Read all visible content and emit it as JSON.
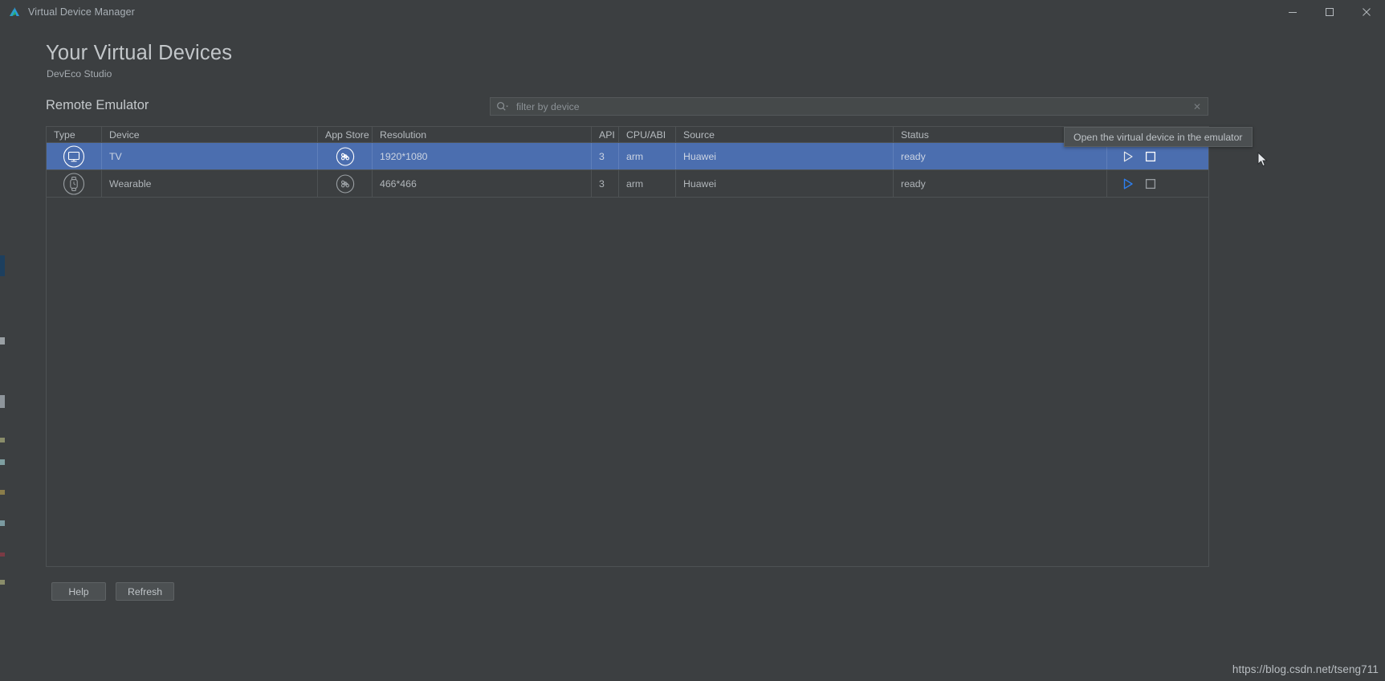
{
  "window": {
    "title": "Virtual Device Manager",
    "app_icon": "deveco-logo-icon",
    "controls": {
      "minimize": "minimize-icon",
      "maximize": "maximize-icon",
      "close": "close-icon"
    }
  },
  "header": {
    "title": "Your Virtual Devices",
    "subtitle": "DevEco Studio",
    "section_title": "Remote Emulator"
  },
  "search": {
    "placeholder": "filter by device",
    "value": "",
    "icon": "search-icon",
    "clear_icon": "clear-icon"
  },
  "table": {
    "columns": [
      "Type",
      "Device",
      "App Store",
      "Resolution",
      "API",
      "CPU/ABI",
      "Source",
      "Status",
      ""
    ],
    "rows": [
      {
        "type_icon": "tv-icon",
        "device": "TV",
        "app_store_icon": "app-store-icon",
        "resolution": "1920*1080",
        "api": "3",
        "cpu_abi": "arm",
        "source": "Huawei",
        "status": "ready",
        "selected": true,
        "actions": [
          "play-icon",
          "stop-icon"
        ]
      },
      {
        "type_icon": "wearable-icon",
        "device": "Wearable",
        "app_store_icon": "app-store-icon",
        "resolution": "466*466",
        "api": "3",
        "cpu_abi": "arm",
        "source": "Huawei",
        "status": "ready",
        "selected": false,
        "actions": [
          "play-icon",
          "stop-icon"
        ]
      }
    ]
  },
  "tooltip": {
    "text": "Open the virtual device in the emulator"
  },
  "footer": {
    "help_label": "Help",
    "refresh_label": "Refresh"
  },
  "watermark": {
    "text": "https://blog.csdn.net/tseng711"
  },
  "colors": {
    "background": "#3c3f41",
    "selection": "#4b6eaf",
    "accent_blue": "#3592f2",
    "border": "#4e5254",
    "text": "#b0b5b9"
  }
}
